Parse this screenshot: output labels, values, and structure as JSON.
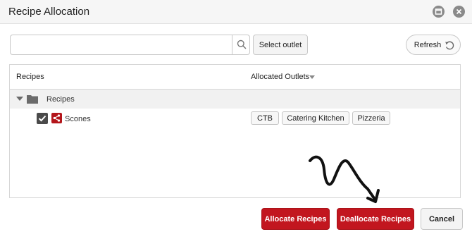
{
  "dialog": {
    "title": "Recipe Allocation"
  },
  "toolbar": {
    "search_value": "",
    "search_placeholder": "",
    "select_outlet_label": "Select outlet",
    "refresh_label": "Refresh"
  },
  "grid": {
    "columns": [
      "Recipes",
      "Allocated Outlets"
    ],
    "group": {
      "label": "Recipes",
      "expanded": true
    },
    "rows": [
      {
        "name": "Scones",
        "checked": true,
        "outlets": [
          "CTB",
          "Catering Kitchen",
          "Pizzeria"
        ]
      }
    ]
  },
  "actions": {
    "allocate_label": "Allocate Recipes",
    "deallocate_label": "Deallocate Recipes",
    "cancel_label": "Cancel"
  },
  "colors": {
    "accent": "#c2161f",
    "title_bar": "#f6f6f6",
    "group_row": "#f1f1f1"
  },
  "icons": {
    "maximize": "maximize-icon",
    "close": "close-icon",
    "search": "search-icon",
    "refresh": "refresh-icon",
    "folder": "folder-icon",
    "recipe": "share-icon",
    "annotation": "hand-drawn-arrow"
  }
}
